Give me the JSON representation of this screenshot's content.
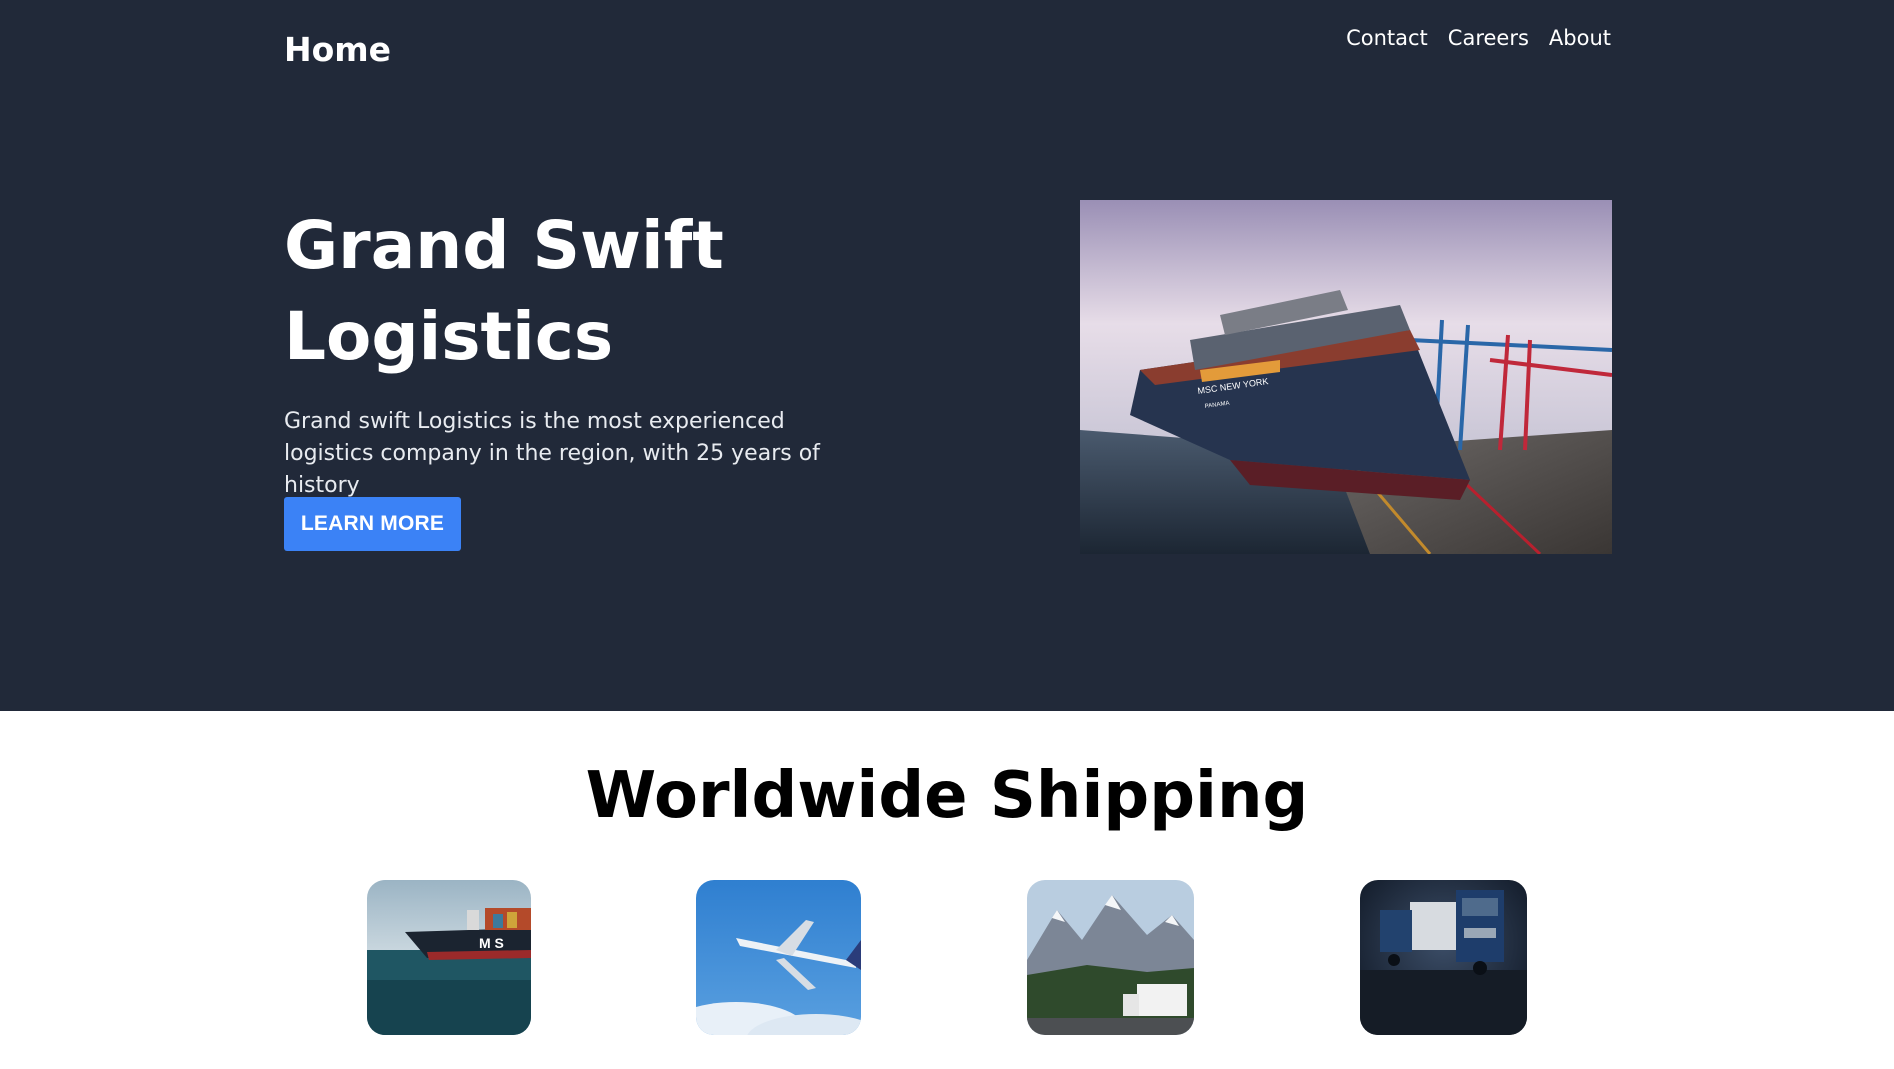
{
  "nav": {
    "brand": "Home",
    "links": [
      "Contact",
      "Careers",
      "About"
    ]
  },
  "hero": {
    "title": "Grand Swift Logistics",
    "description": "Grand swift Logistics is the most experienced logistics company in the region, with 25 years of history",
    "button_label": "LEARN MORE",
    "image_ship_name": "MSC NEW YORK",
    "image_ship_port": "PANAMA"
  },
  "shipping": {
    "title": "Worldwide Shipping",
    "tiles": [
      "sea-freight-image",
      "air-freight-image",
      "road-freight-image",
      "truck-fleet-image"
    ],
    "ship_hull_text": "M S"
  },
  "colors": {
    "hero_bg": "#212939",
    "accent": "#3b82f6",
    "page_bg": "#ffffff"
  }
}
